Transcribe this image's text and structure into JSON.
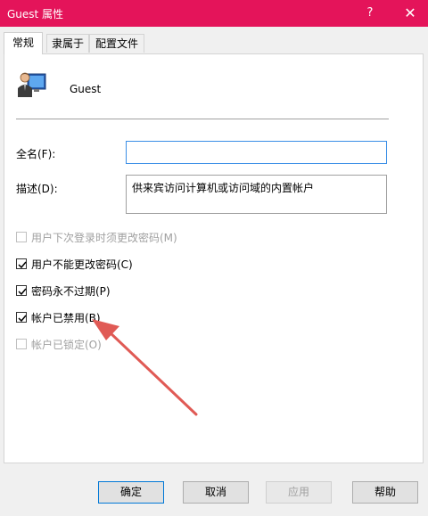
{
  "window": {
    "title": "Guest 属性",
    "help_glyph": "?",
    "close_glyph": "✕",
    "accent_color": "#e4145a"
  },
  "tabs": [
    {
      "label": "常规",
      "active": true
    },
    {
      "label": "隶属于",
      "active": false
    },
    {
      "label": "配置文件",
      "active": false
    }
  ],
  "general": {
    "user_icon": "user-account-icon",
    "username": "Guest",
    "fullname_label": "全名(F):",
    "fullname_value": "",
    "description_label": "描述(D):",
    "description_value": "供来宾访问计算机或访问域的内置帐户",
    "checkboxes": [
      {
        "label": "用户下次登录时须更改密码(M)",
        "checked": false,
        "enabled": false
      },
      {
        "label": "用户不能更改密码(C)",
        "checked": true,
        "enabled": true
      },
      {
        "label": "密码永不过期(P)",
        "checked": true,
        "enabled": true
      },
      {
        "label": "帐户已禁用(B)",
        "checked": true,
        "enabled": true
      },
      {
        "label": "帐户已锁定(O)",
        "checked": false,
        "enabled": false
      }
    ]
  },
  "buttons": {
    "ok": "确定",
    "cancel": "取消",
    "apply": "应用",
    "help": "帮助"
  },
  "annotation": {
    "arrow_color": "#e05a55"
  }
}
